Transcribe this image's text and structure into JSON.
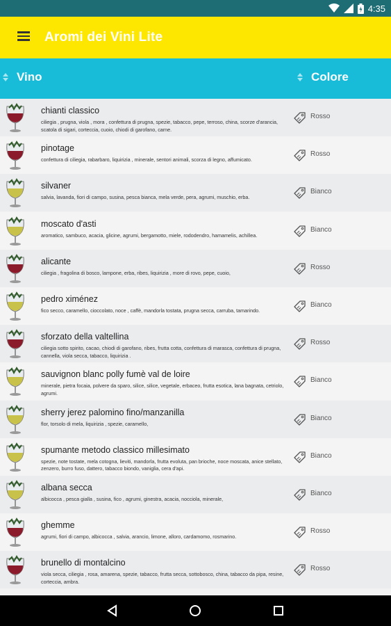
{
  "status_bar": {
    "time": "4:35",
    "icons": [
      "wifi-icon",
      "signal-icon",
      "battery-icon"
    ]
  },
  "app_bar": {
    "title": "Aromi dei Vini Lite",
    "menu_icon": "hamburger-menu-icon"
  },
  "table_header": {
    "col_vino": "Vino",
    "col_colore": "Colore"
  },
  "colors": {
    "status_bar": "#1e6d74",
    "app_bar": "#fde700",
    "header": "#18bcd8",
    "rosso": "#8b1a2b",
    "bianco": "#c9c24a"
  },
  "wines": [
    {
      "name": "chianti classico",
      "desc": "ciliegia , prugna, viola , mora , confettura di prugna, spezie, tabacco, pepe, terroso, china, scorze d'arancia, scatola di sigari, corteccia, cuoio, chiodi di garofano, carne.",
      "color": "Rosso"
    },
    {
      "name": "pinotage",
      "desc": "confettura di ciliegia, rabarbaro, liquirizia , minerale, sentori animali, scorza di legno, affumicato.",
      "color": "Rosso"
    },
    {
      "name": "silvaner",
      "desc": "salvia, lavanda, fiori di campo, susina, pesca bianca, mela verde, pera, agrumi, muschio, erba.",
      "color": "Bianco"
    },
    {
      "name": "moscato d'asti",
      "desc": "aromatico, sambuco, acacia, glicine, agrumi, bergamotto, miele, rododendro, hamamelis, achillea.",
      "color": "Bianco"
    },
    {
      "name": "alicante",
      "desc": "ciliegia , fragolina di bosco, lampone, erba, ribes, liquirizia , more di rovo, pepe, cuoio,",
      "color": "Rosso"
    },
    {
      "name": "pedro ximénez",
      "desc": "fico secco, caramello, cioccolato, noce , caffè, mandorla tostata, prugna secca, carruba, tamarindo.",
      "color": "Bianco"
    },
    {
      "name": "sforzato della valtellina",
      "desc": "ciliegia sotto spirito, cacao, chiodi di garofano, ribes, frutta cotta, confettura di marasca, confettura di prugna, cannella, viola secca, tabacco, liquirizia .",
      "color": "Rosso"
    },
    {
      "name": "sauvignon blanc polly fumè val de loire",
      "desc": "minerale, pietra focaia, polvere da sparo, silice, silice, vegetale, erbaceo, frutta esotica, lana bagnata, cetriolo, agrumi.",
      "color": "Bianco"
    },
    {
      "name": "sherry jerez palomino fino/manzanilla",
      "desc": "flor, torsolo di mela, liquirizia , spezie, caramello,",
      "color": "Bianco"
    },
    {
      "name": "spumante metodo classico millesimato",
      "desc": "spezie, note tostate, mela cotogna, lieviti, mandorla, frutta evoluta, pan brioche, noce moscata, anice stellato, zenzero, burro fuso, dattero, tabacco biondo, vaniglia, cera d'api.",
      "color": "Bianco"
    },
    {
      "name": "albana secca",
      "desc": "albicocca , pesca gialla , susina, fico , agrumi, ginestra, acacia, nocciola, minerale,",
      "color": "Bianco"
    },
    {
      "name": "ghemme",
      "desc": "agrumi, fiori di campo, albicocca , salvia, arancio, limone, alloro, cardamomo, rosmarino.",
      "color": "Rosso"
    },
    {
      "name": "brunello di montalcino",
      "desc": "viola secca, ciliegia , rosa, amarena, spezie, tabacco, frutta secca, sottobosco, china, tabacco da pipa, resine, corteccia, ambra.",
      "color": "Rosso"
    }
  ],
  "nav_bar": {
    "icons": [
      "back-icon",
      "home-icon",
      "recents-icon"
    ]
  }
}
